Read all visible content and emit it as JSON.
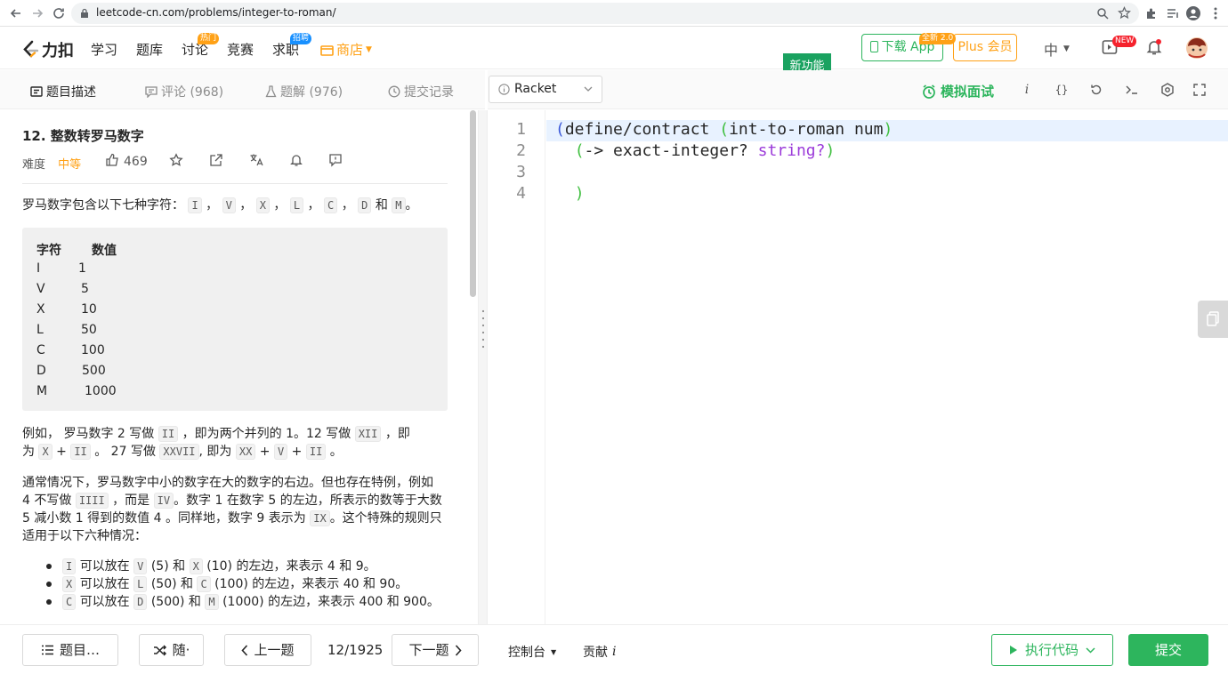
{
  "browser": {
    "url": "leetcode-cn.com/problems/integer-to-roman/"
  },
  "site": {
    "logo_text": "力扣",
    "nav": [
      "学习",
      "题库",
      "讨论",
      "竞赛",
      "求职"
    ],
    "discuss_badge": "热门",
    "jobs_badge": "招聘",
    "shop_label": "商店",
    "new_feature_label": "新功能",
    "download_label": "下载 App",
    "download_badge": "全新 2.0",
    "plus_label": "Plus 会员",
    "lang_label": "中",
    "video_badge": "NEW"
  },
  "tabs": {
    "description": "题目描述",
    "comments": "评论 (968)",
    "solutions": "题解 (976)",
    "submissions": "提交记录"
  },
  "editor_toolbar": {
    "language": "Racket",
    "mock_interview": "模拟面试",
    "info_glyph": "i",
    "braces_glyph": "{}"
  },
  "problem": {
    "title": "12. 整数转罗马数字",
    "difficulty_label": "难度",
    "difficulty": "中等",
    "likes": "469",
    "intro_prefix": "罗马数字包含以下七种字符：",
    "intro_chars": [
      "I",
      "V",
      "X",
      "L",
      "C",
      "D",
      "M"
    ],
    "intro_and": "和",
    "table_header": [
      "字符",
      "数值"
    ],
    "table_rows": [
      [
        "I",
        "1"
      ],
      [
        "V",
        "5"
      ],
      [
        "X",
        "10"
      ],
      [
        "L",
        "50"
      ],
      [
        "C",
        "100"
      ],
      [
        "D",
        "500"
      ],
      [
        "M",
        "1000"
      ]
    ],
    "example_p": {
      "t1": "例如， 罗马数字 2 写做",
      "c1": "II",
      "t2": "，即为两个并列的 1。12 写做",
      "c2": "XII",
      "t3": "，即",
      "t4": "为",
      "c3": "X",
      "t5": "+",
      "c4": "II",
      "t6": "。 27 写做",
      "c5": "XXVII",
      "t7": ", 即为",
      "c6": "XX",
      "t8": "+",
      "c7": "V",
      "t9": "+",
      "c8": "II",
      "t10": "。"
    },
    "rule_p": {
      "l1": "通常情况下，罗马数字中小的数字在大的数字的右边。但也存在特例，例如",
      "t1": "4 不写做",
      "c1": "IIII",
      "t2": "，而是",
      "c2": "IV",
      "t3": "。数字 1 在数字 5 的左边，所表示的数等于大数",
      "t4": "5 减小数 1 得到的数值 4 。同样地，数字 9 表示为",
      "c3": "IX",
      "t5": "。这个特殊的规则只",
      "l4": "适用于以下六种情况："
    },
    "bullets": [
      {
        "a": "I",
        "t1": "可以放在",
        "b": "V",
        "t2": "(5) 和",
        "c": "X",
        "t3": "(10) 的左边，来表示 4 和 9。"
      },
      {
        "a": "X",
        "t1": "可以放在",
        "b": "L",
        "t2": "(50) 和",
        "c": "C",
        "t3": "(100) 的左边，来表示 40 和 90。"
      },
      {
        "a": "C",
        "t1": "可以放在",
        "b": "D",
        "t2": "(500) 和",
        "c": "M",
        "t3": "(1000) 的左边，来表示 400 和 900。"
      }
    ]
  },
  "code": {
    "line_numbers": [
      "1",
      "2",
      "3",
      "4"
    ],
    "l1_open": "(",
    "l1_text": "define/contract ",
    "l1_inner_open": "(",
    "l1_inner": "int-to-roman num",
    "l1_inner_close": ")",
    "l2_indent": "  ",
    "l2_open": "(",
    "l2_arrow": "-> exact-integer? ",
    "l2_string": "string?",
    "l2_close": ")",
    "l4_indent": "  ",
    "l4_close": ")"
  },
  "bottom": {
    "problem_list": "题目…",
    "random": "随·",
    "prev": "上一题",
    "counter": "12/1925",
    "next": "下一题",
    "console": "控制台",
    "contribute": "贡献",
    "contribute_glyph": "i",
    "run": "执行代码",
    "submit": "提交"
  },
  "colors": {
    "brand_orange": "#ffa116",
    "green": "#2db55d",
    "submit_green": "#2db55d",
    "paren_green": "#40bf40",
    "string_purple": "#9b3bd9"
  }
}
